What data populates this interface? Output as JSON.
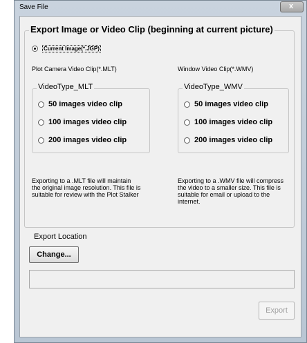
{
  "window": {
    "title": "Save File",
    "close_label": "x"
  },
  "main_group": {
    "legend": "Export Image or Video Clip (beginning at current picture)"
  },
  "current_image": {
    "label": "Current Image(*.JGP)",
    "checked": true
  },
  "mlt": {
    "heading": "Plot Camera Video Clip(*.MLT)",
    "group_legend": "VideoType_MLT",
    "options": [
      "50 images video clip",
      "100 images video clip",
      "200 images video clip"
    ],
    "description": "Exporting to a .MLT file will maintain the original image resolution. This file is suitable for review with the Plot Stalker"
  },
  "wmv": {
    "heading": "Window Video Clip(*.WMV)",
    "group_legend": "VideoType_WMV",
    "options": [
      "50 images video clip",
      "100 images video clip",
      "200 images video clip"
    ],
    "description": "Exporting to a .WMV file will compress the video to a smaller size.  This file is suitable for email or upload to the internet."
  },
  "export_location": {
    "label": "Export Location",
    "change_button": "Change...",
    "path_value": ""
  },
  "export_button": {
    "label": "Export",
    "enabled": false
  }
}
